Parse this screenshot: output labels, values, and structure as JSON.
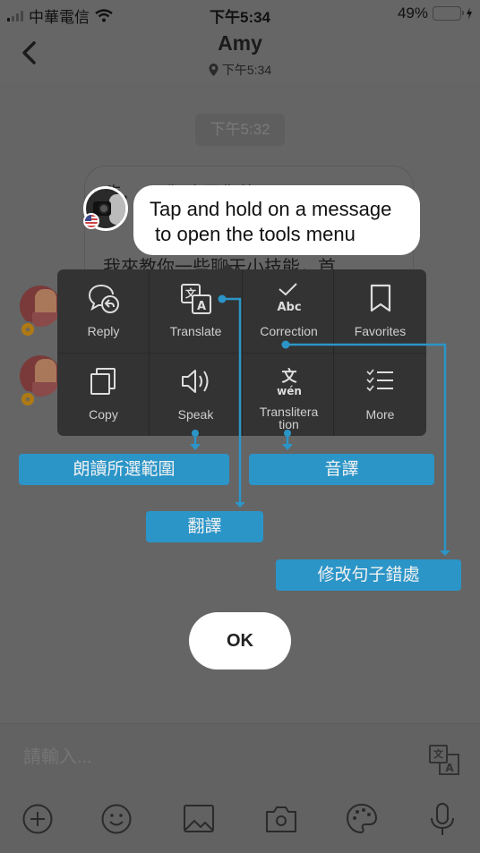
{
  "status_bar": {
    "carrier": "中華電信",
    "time": "下午5:34",
    "battery_percent": "49%",
    "battery_level": 0.49
  },
  "nav": {
    "title": "Amy",
    "subtitle": "下午5:34",
    "back_icon": "chevron-left-icon",
    "location_icon": "location-pin-icon"
  },
  "chat": {
    "timestamp": "下午5:32",
    "message_line1": "嗨，      ：我叫       是你的",
    "message_line2": "我來教你一些聊天小技能，首"
  },
  "tip": {
    "line1": "Tap and hold on a message",
    "line2": "to open the tools menu"
  },
  "menu": {
    "items": [
      {
        "label": "Reply",
        "icon": "reply-bubble-icon"
      },
      {
        "label": "Translate",
        "icon": "translate-icon"
      },
      {
        "label": "Correction",
        "icon": "check-abc-icon"
      },
      {
        "label": "Favorites",
        "icon": "bookmark-icon"
      },
      {
        "label": "Copy",
        "icon": "copy-icon"
      },
      {
        "label": "Speak",
        "icon": "speaker-icon"
      },
      {
        "label": "Translitera\ntion",
        "icon": "transliteration-icon"
      },
      {
        "label": "More",
        "icon": "checklist-icon"
      }
    ]
  },
  "callouts": {
    "speak": "朗讀所選範圍",
    "transliteration": "音譯",
    "translate": "翻譯",
    "correction": "修改句子錯處"
  },
  "colors": {
    "accent": "#2b95c8",
    "overlay": "#666666",
    "menu_bg": "#333333",
    "battery": "#4cd964"
  },
  "ok_button": "OK",
  "input": {
    "placeholder": "請輸入...",
    "tools": [
      "plus-circle-icon",
      "smiley-icon",
      "image-icon",
      "camera-icon",
      "palette-icon",
      "microphone-icon"
    ]
  }
}
